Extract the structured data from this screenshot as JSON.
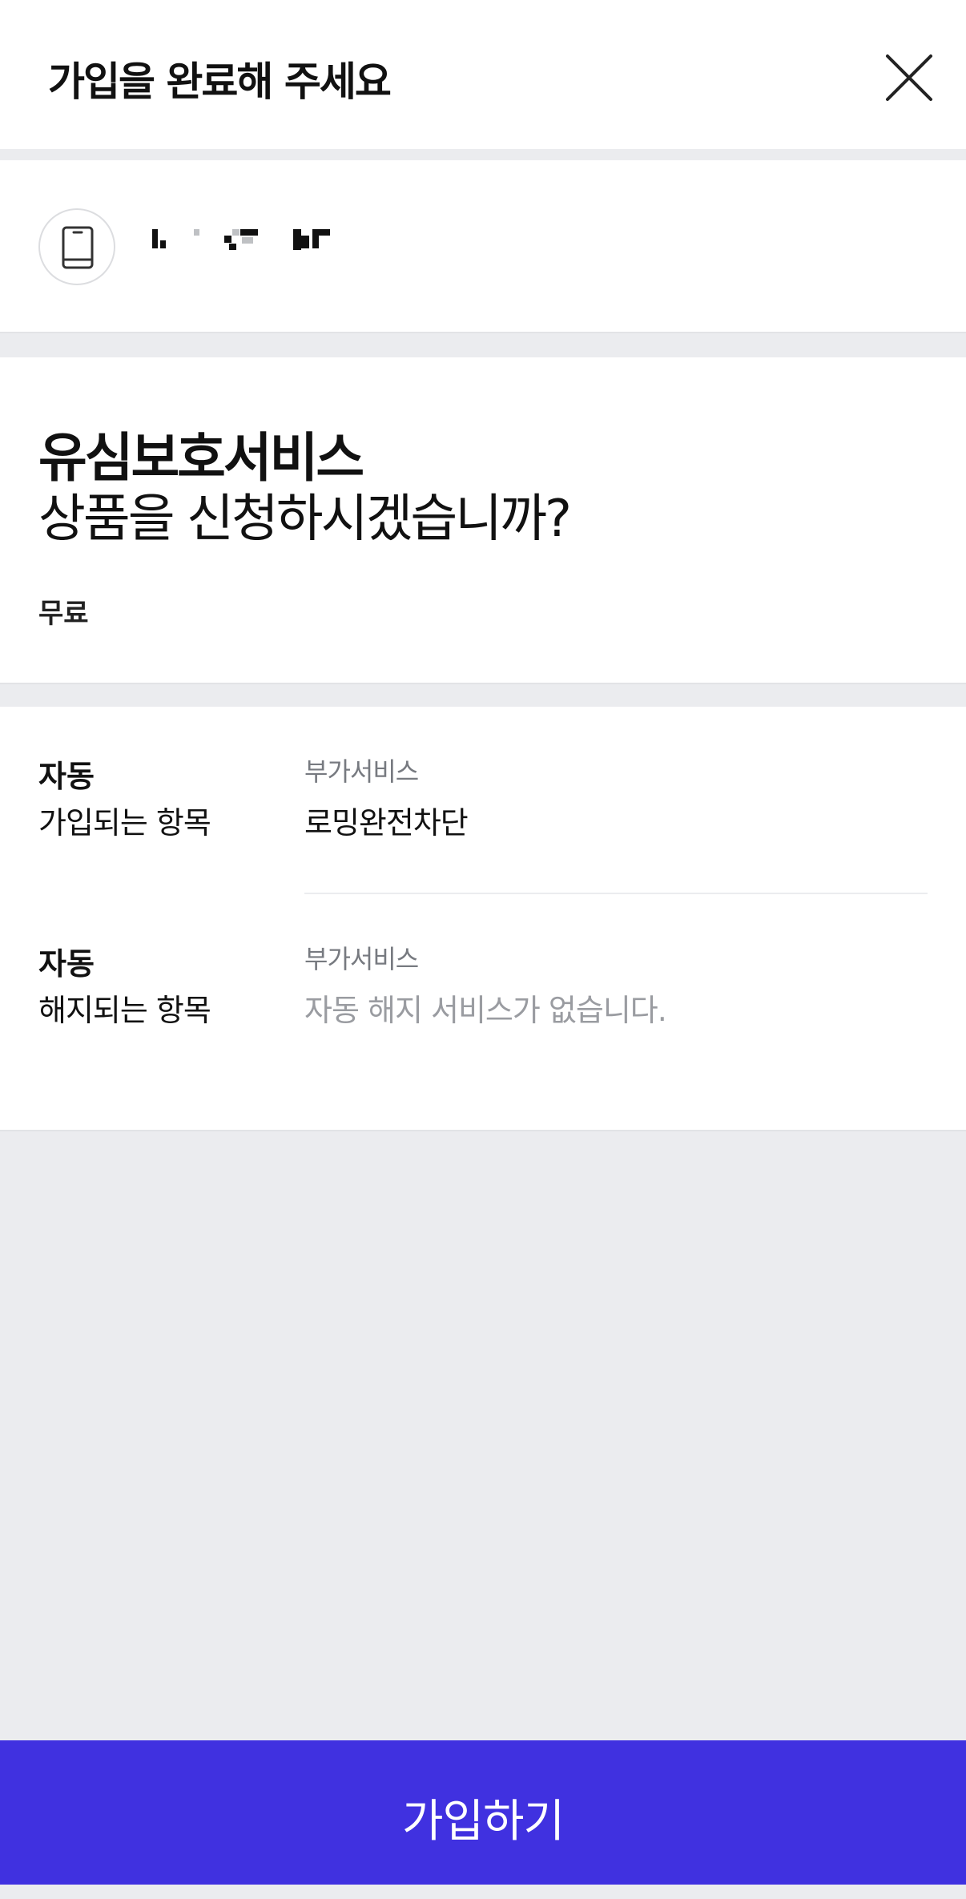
{
  "header": {
    "title": "가입을 완료해 주세요",
    "close_icon": "close-icon"
  },
  "phone": {
    "icon": "smartphone-icon",
    "number_masked": true
  },
  "product": {
    "name": "유심보호서비스",
    "question": "상품을 신청하시겠습니까?",
    "price": "무료"
  },
  "items": {
    "auto_join": {
      "label_strong": "자동",
      "label": "가입되는 항목",
      "category": "부가서비스",
      "value": "로밍완전차단"
    },
    "auto_cancel": {
      "label_strong": "자동",
      "label": "해지되는 항목",
      "category": "부가서비스",
      "value": "자동 해지 서비스가 없습니다."
    }
  },
  "footer": {
    "join_button_label": "가입하기"
  },
  "colors": {
    "accent": "#4031e0",
    "background": "#ebecef",
    "muted_text": "#9a9ca1"
  }
}
